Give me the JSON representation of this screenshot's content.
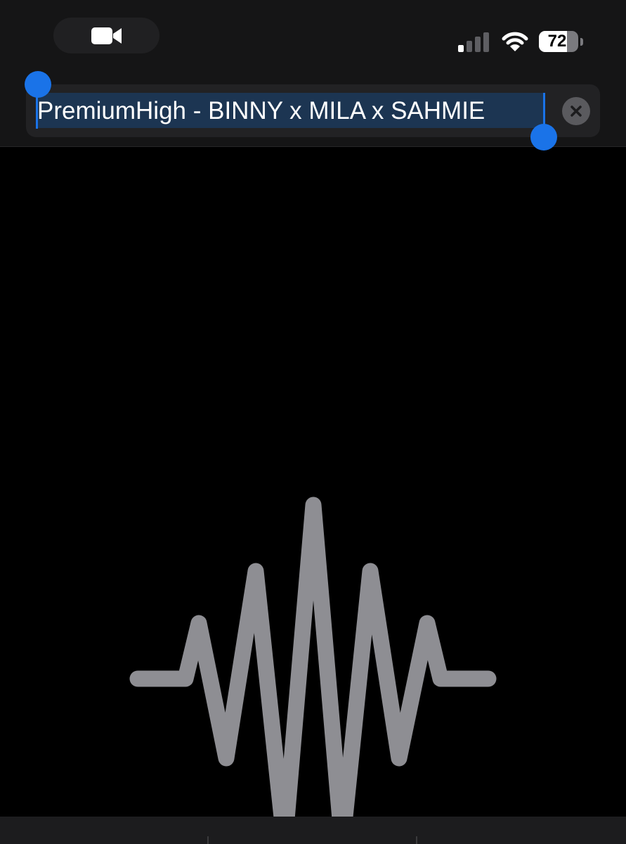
{
  "status_bar": {
    "battery_level": "72",
    "icons": [
      "video-camera-icon",
      "cellular-signal-icon",
      "wifi-icon",
      "battery-icon"
    ]
  },
  "title_field": {
    "value": "PremiumHigh - BINNY x MILA x SAHMIE",
    "selected": true,
    "clear_icon": "clear-icon"
  },
  "main": {
    "icon": "waveform-icon"
  },
  "colors": {
    "selection_handle": "#1a73e8",
    "selection_highlight": "#1c3552",
    "waveform": "#8e8e93",
    "background": "#000000",
    "top_area": "#151516"
  }
}
